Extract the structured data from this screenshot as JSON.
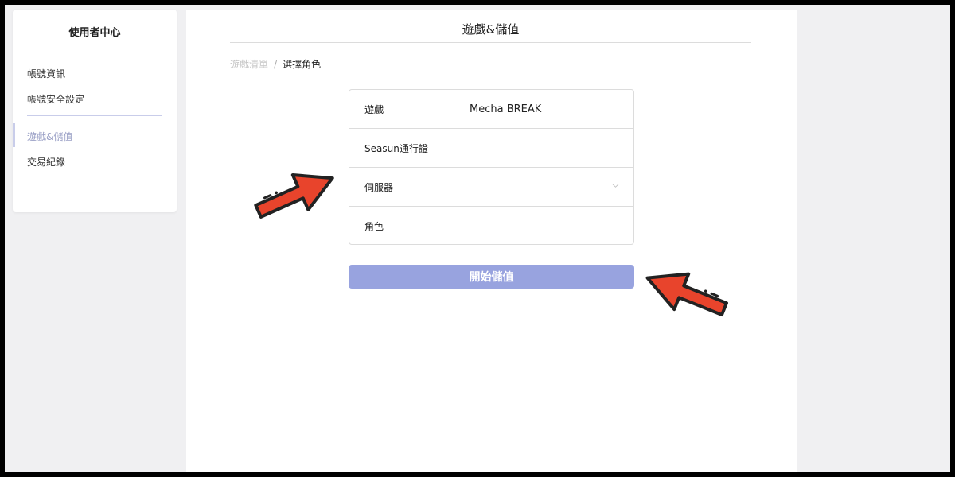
{
  "sidebar": {
    "title": "使用者中心",
    "items": [
      {
        "label": "帳號資訊"
      },
      {
        "label": "帳號安全設定"
      },
      {
        "label": "遊戲&儲值"
      },
      {
        "label": "交易紀錄"
      }
    ],
    "active_index": 2
  },
  "main": {
    "title": "遊戲&儲值",
    "breadcrumb": {
      "link": "遊戲清單",
      "separator": "/",
      "current": "選擇角色"
    },
    "form": {
      "rows": [
        {
          "label": "遊戲",
          "value": "Mecha BREAK"
        },
        {
          "label": "Seasun通行證",
          "value": ""
        },
        {
          "label": "伺服器",
          "value": ""
        },
        {
          "label": "角色",
          "value": ""
        }
      ]
    },
    "submit_label": "開始儲值"
  },
  "colors": {
    "accent": "#98a3df",
    "arrow": "#e8442c"
  },
  "icons": {
    "server_select": "chevron-down-icon",
    "annotation_arrows": [
      "red-arrow-icon",
      "red-arrow-icon"
    ]
  }
}
